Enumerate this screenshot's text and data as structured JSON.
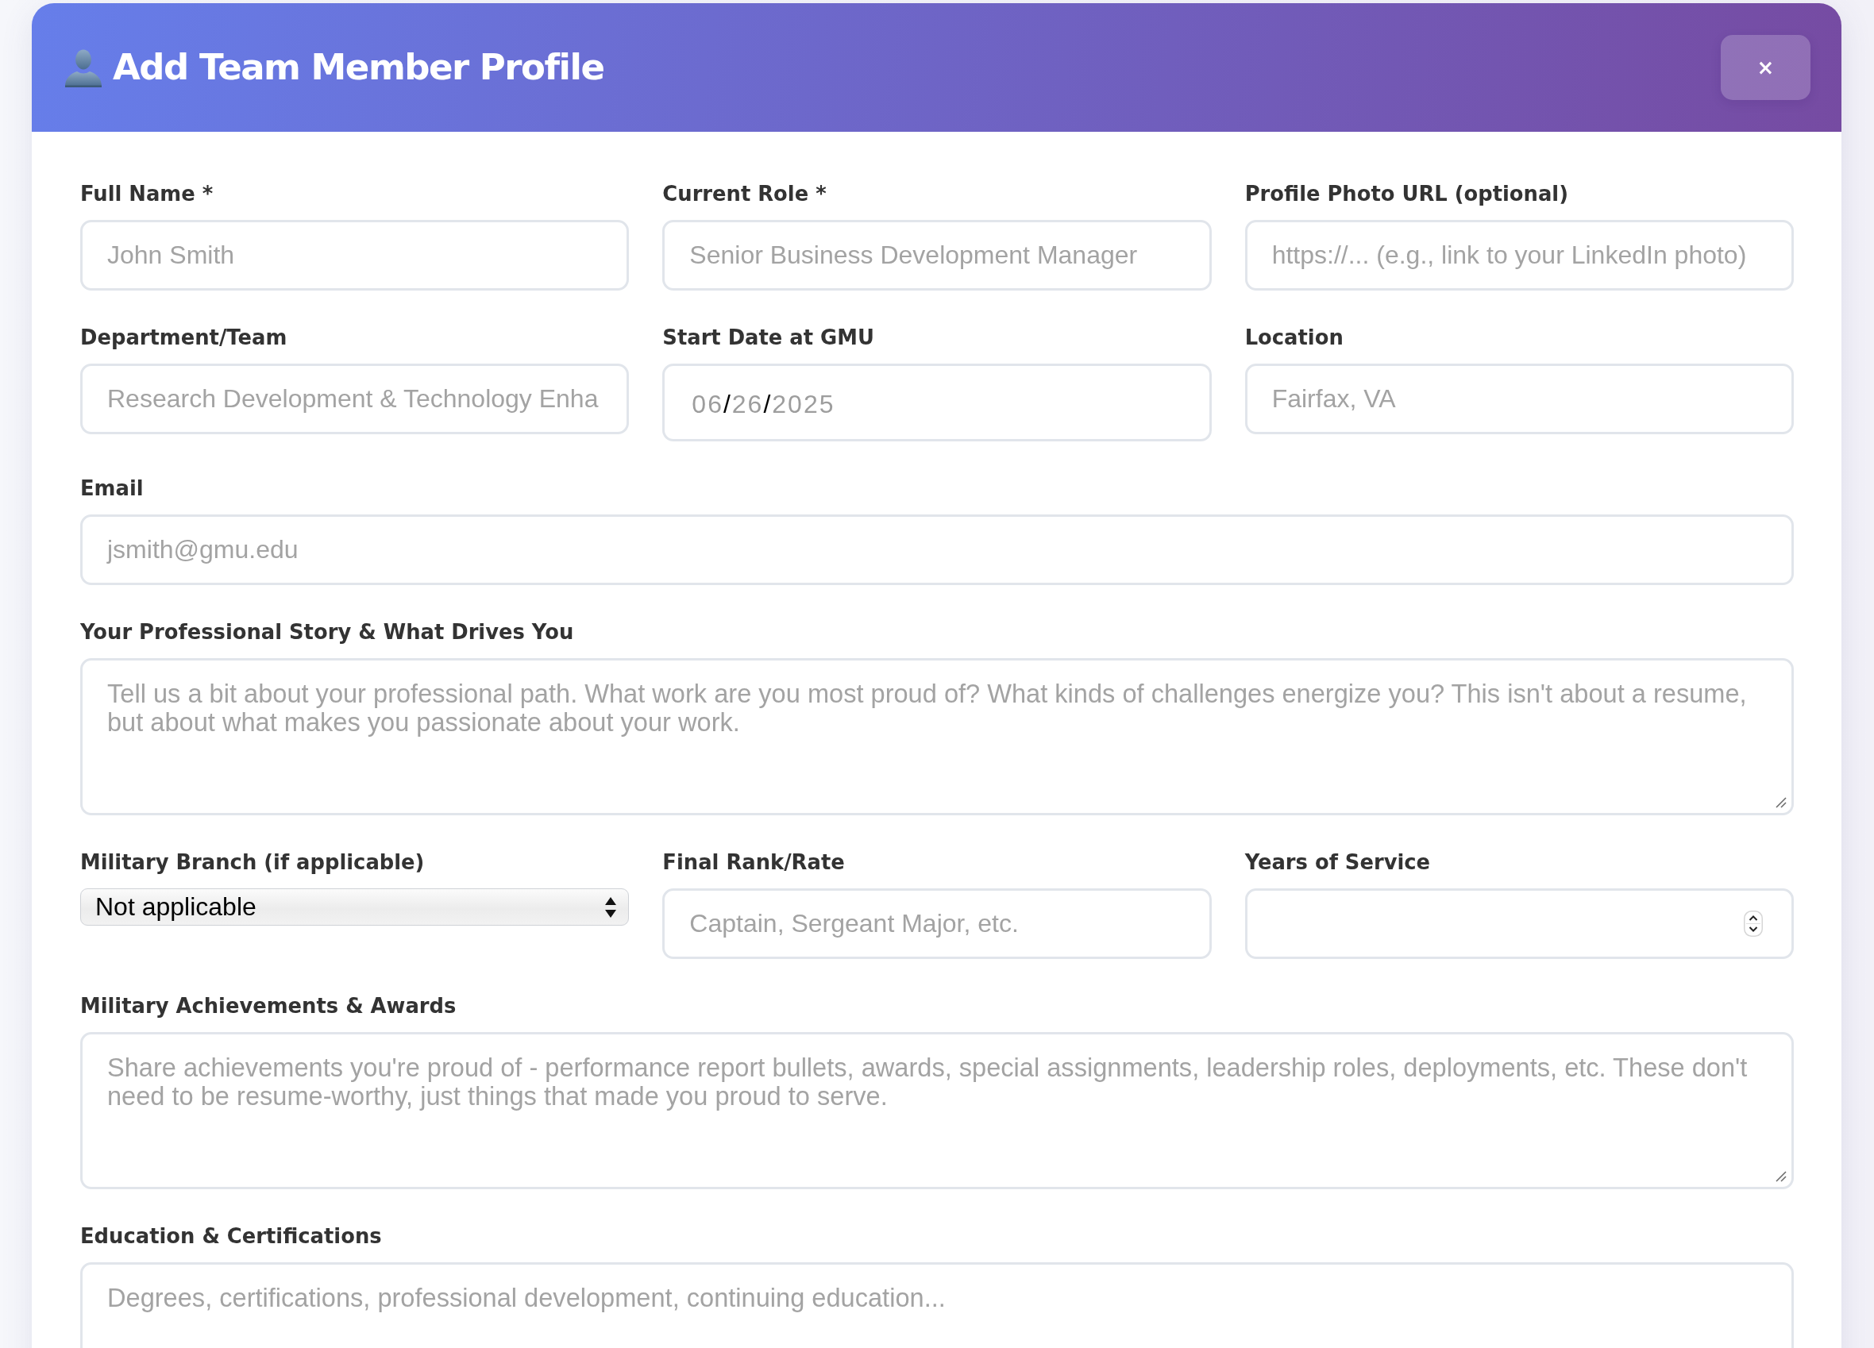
{
  "dialog": {
    "title": "Add Team Member Profile",
    "close_button": {
      "label": "×"
    }
  },
  "form": {
    "rows": [
      {
        "fields": [
          {
            "kind": "text",
            "label": "Full Name *",
            "placeholder": "John Smith"
          },
          {
            "kind": "text",
            "label": "Current Role *",
            "placeholder": "Senior Business Development Manager"
          },
          {
            "kind": "text",
            "label": "Profile Photo URL (optional)",
            "placeholder": "https://... (e.g., link to your LinkedIn photo)"
          }
        ]
      },
      {
        "fields": [
          {
            "kind": "text",
            "label": "Department/Team",
            "placeholder": "Research Development & Technology Enha"
          },
          {
            "kind": "date",
            "label": "Start Date at GMU",
            "placeholder": "06/26/2025"
          },
          {
            "kind": "text",
            "label": "Location",
            "placeholder": "Fairfax, VA"
          }
        ]
      },
      {
        "fields": [
          {
            "kind": "text",
            "label": "Email",
            "placeholder": "jsmith@gmu.edu"
          }
        ]
      },
      {
        "fields": [
          {
            "kind": "textarea",
            "label": "Your Professional Story & What Drives You",
            "placeholder": "Tell us a bit about your professional path. What work are you most proud of? What kinds of challenges energize you? This isn't about a resume, but about what makes you passionate about your work."
          }
        ]
      },
      {
        "fields": [
          {
            "kind": "select",
            "label": "Military Branch (if applicable)",
            "value": "Not applicable"
          },
          {
            "kind": "text",
            "label": "Final Rank/Rate",
            "placeholder": "Captain, Sergeant Major, etc."
          },
          {
            "kind": "number",
            "label": "Years of Service"
          }
        ]
      },
      {
        "fields": [
          {
            "kind": "textarea",
            "label": "Military Achievements & Awards",
            "placeholder": "Share achievements you're proud of - performance report bullets, awards, special assignments, leadership roles, deployments, etc. These don't need to be resume-worthy, just things that made you proud to serve."
          }
        ]
      },
      {
        "fields": [
          {
            "kind": "textarea",
            "label": "Education & Certifications",
            "placeholder": "Degrees, certifications, professional development, continuing education..."
          }
        ]
      }
    ]
  }
}
